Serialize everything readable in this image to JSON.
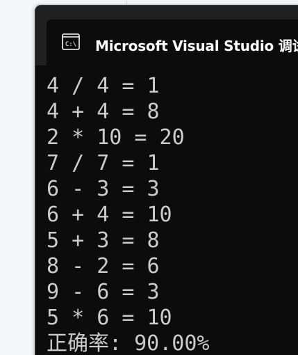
{
  "window": {
    "title": "Microsoft Visual Studio 调试控制台",
    "icon": "console-app-icon",
    "icon_text": "C:\\",
    "colors": {
      "titlebar": "#202020",
      "console_background": "#0c0c0c",
      "console_text": "#cccccc",
      "title_text": "#ffffff"
    }
  },
  "console": {
    "lines": [
      "4 / 4 = 1",
      "4 + 4 = 8",
      "2 * 10 = 20",
      "7 / 7 = 1",
      "6 - 3 = 3",
      "6 + 4 = 10",
      "5 + 3 = 8",
      "8 - 2 = 6",
      "9 - 6 = 3",
      "5 * 6 = 10",
      "正确率: 90.00%"
    ]
  }
}
